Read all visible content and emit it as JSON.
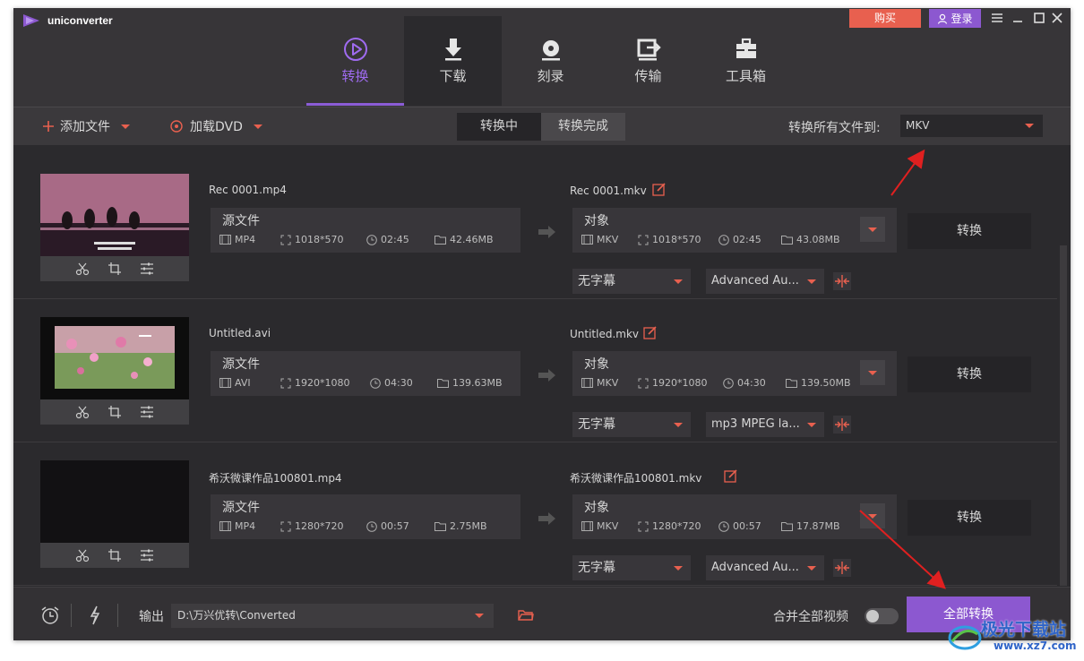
{
  "app": {
    "title": "uniconverter",
    "buy": "购买",
    "login": "登录"
  },
  "nav": [
    {
      "label": "转换",
      "icon": "convert-icon"
    },
    {
      "label": "下载",
      "icon": "download-icon"
    },
    {
      "label": "刻录",
      "icon": "disc-icon"
    },
    {
      "label": "传输",
      "icon": "transfer-icon"
    },
    {
      "label": "工具箱",
      "icon": "toolbox-icon"
    }
  ],
  "toolbar": {
    "add_file": "添加文件",
    "load_dvd": "加载DVD",
    "tab_converting": "转换中",
    "tab_done": "转换完成",
    "convert_all_to": "转换所有文件到:",
    "format": "MKV"
  },
  "files": [
    {
      "source_name": "Rec 0001.mp4",
      "source_label": "源文件",
      "source": {
        "format": "MP4",
        "resolution": "1018*570",
        "duration": "02:45",
        "size": "42.46MB"
      },
      "target_name": "Rec 0001.mkv",
      "target_label": "对象",
      "target": {
        "format": "MKV",
        "resolution": "1018*570",
        "duration": "02:45",
        "size": "43.08MB"
      },
      "subtitle": "无字幕",
      "audio": "Advanced Au...",
      "convert": "转换"
    },
    {
      "source_name": "Untitled.avi",
      "source_label": "源文件",
      "source": {
        "format": "AVI",
        "resolution": "1920*1080",
        "duration": "04:30",
        "size": "139.63MB"
      },
      "target_name": "Untitled.mkv",
      "target_label": "对象",
      "target": {
        "format": "MKV",
        "resolution": "1920*1080",
        "duration": "04:30",
        "size": "139.50MB"
      },
      "subtitle": "无字幕",
      "audio": "mp3 MPEG la...",
      "convert": "转换"
    },
    {
      "source_name": "希沃微课作品100801.mp4",
      "source_label": "源文件",
      "source": {
        "format": "MP4",
        "resolution": "1280*720",
        "duration": "00:57",
        "size": "2.75MB"
      },
      "target_name": "希沃微课作品100801.mkv",
      "target_label": "对象",
      "target": {
        "format": "MKV",
        "resolution": "1280*720",
        "duration": "00:57",
        "size": "17.87MB"
      },
      "subtitle": "无字幕",
      "audio": "Advanced Au...",
      "convert": "转换"
    }
  ],
  "footer": {
    "output_label": "输出",
    "output_path": "D:\\万兴优转\\Converted",
    "merge_label": "合并全部视频",
    "merge_on": false,
    "convert_all": "全部转换"
  },
  "watermark": {
    "text": "极光下载站",
    "url": "www.xz7.com"
  },
  "colors": {
    "accent": "#8c58d0",
    "buy": "#e8604f",
    "annotation_arrow": "#e02020"
  }
}
